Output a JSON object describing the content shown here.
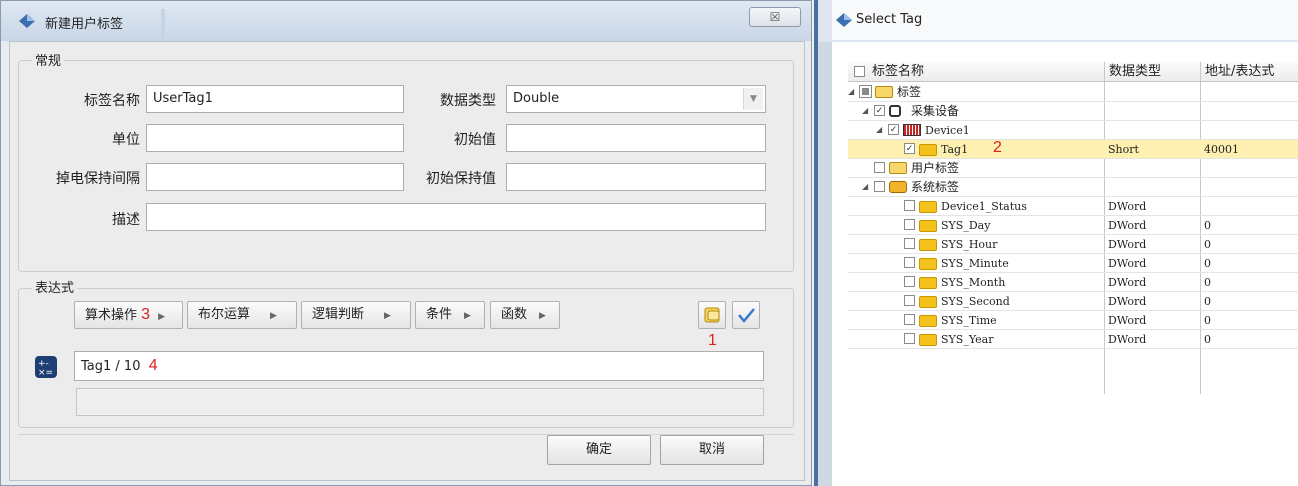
{
  "dialog": {
    "title": "新建用户标签",
    "close_glyph": "☒",
    "general_group": "常规",
    "labels": {
      "name": "标签名称",
      "datatype": "数据类型",
      "unit": "单位",
      "initial": "初始值",
      "retain_interval": "掉电保持间隔",
      "retain_initial": "初始保持值",
      "desc": "描述"
    },
    "values": {
      "name": "UserTag1",
      "datatype": "Double",
      "unit": "",
      "initial": "",
      "retain_interval": "",
      "retain_initial": "",
      "desc": ""
    },
    "expr_group": "表达式",
    "operators": [
      "算术操作",
      "布尔运算",
      "逻辑判断",
      "条件",
      "函数"
    ],
    "expression": "Tag1  / 10",
    "markers": {
      "m1": "1",
      "m2": "2",
      "m3": "3",
      "m4": "4"
    },
    "ok_label": "确定",
    "cancel_label": "取消"
  },
  "tag_window": {
    "title": "Select Tag",
    "columns": [
      "标签名称",
      "数据类型",
      "地址/表达式"
    ],
    "tree": {
      "root": "标签",
      "device_group": "采集设备",
      "device": "Device1",
      "selected_tag": {
        "name": "Tag1",
        "type": "Short",
        "address": "40001"
      },
      "user_tags": "用户标签",
      "system_tags": "系统标签",
      "system_items": [
        {
          "name": "Device1_Status",
          "type": "DWord",
          "address": ""
        },
        {
          "name": "SYS_Day",
          "type": "DWord",
          "address": "0"
        },
        {
          "name": "SYS_Hour",
          "type": "DWord",
          "address": "0"
        },
        {
          "name": "SYS_Minute",
          "type": "DWord",
          "address": "0"
        },
        {
          "name": "SYS_Month",
          "type": "DWord",
          "address": "0"
        },
        {
          "name": "SYS_Second",
          "type": "DWord",
          "address": "0"
        },
        {
          "name": "SYS_Time",
          "type": "DWord",
          "address": "0"
        },
        {
          "name": "SYS_Year",
          "type": "DWord",
          "address": "0"
        }
      ]
    }
  },
  "colors": {
    "highlight_row": "#fdf0b0",
    "marker_red": "#e02020",
    "title_blue": "#c9d6e6"
  }
}
